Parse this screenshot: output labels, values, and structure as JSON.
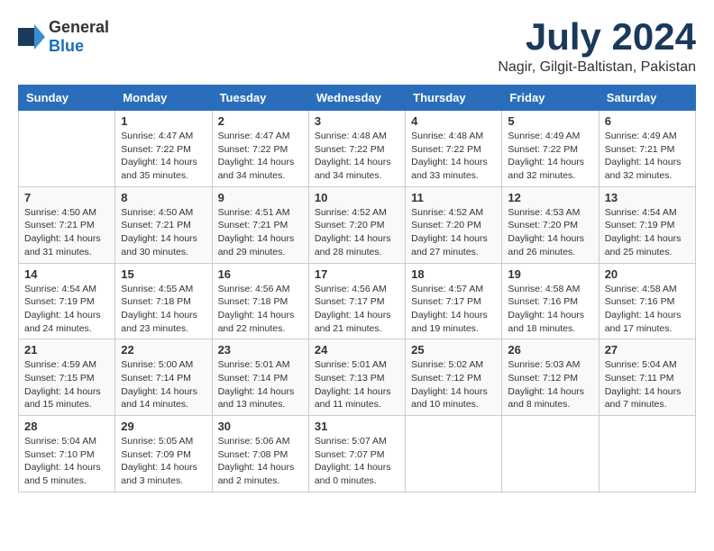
{
  "header": {
    "logo_general": "General",
    "logo_blue": "Blue",
    "month_title": "July 2024",
    "location": "Nagir, Gilgit-Baltistan, Pakistan"
  },
  "days_of_week": [
    "Sunday",
    "Monday",
    "Tuesday",
    "Wednesday",
    "Thursday",
    "Friday",
    "Saturday"
  ],
  "weeks": [
    [
      {
        "day": "",
        "sunrise": "",
        "sunset": "",
        "daylight": ""
      },
      {
        "day": "1",
        "sunrise": "Sunrise: 4:47 AM",
        "sunset": "Sunset: 7:22 PM",
        "daylight": "Daylight: 14 hours and 35 minutes."
      },
      {
        "day": "2",
        "sunrise": "Sunrise: 4:47 AM",
        "sunset": "Sunset: 7:22 PM",
        "daylight": "Daylight: 14 hours and 34 minutes."
      },
      {
        "day": "3",
        "sunrise": "Sunrise: 4:48 AM",
        "sunset": "Sunset: 7:22 PM",
        "daylight": "Daylight: 14 hours and 34 minutes."
      },
      {
        "day": "4",
        "sunrise": "Sunrise: 4:48 AM",
        "sunset": "Sunset: 7:22 PM",
        "daylight": "Daylight: 14 hours and 33 minutes."
      },
      {
        "day": "5",
        "sunrise": "Sunrise: 4:49 AM",
        "sunset": "Sunset: 7:22 PM",
        "daylight": "Daylight: 14 hours and 32 minutes."
      },
      {
        "day": "6",
        "sunrise": "Sunrise: 4:49 AM",
        "sunset": "Sunset: 7:21 PM",
        "daylight": "Daylight: 14 hours and 32 minutes."
      }
    ],
    [
      {
        "day": "7",
        "sunrise": "Sunrise: 4:50 AM",
        "sunset": "Sunset: 7:21 PM",
        "daylight": "Daylight: 14 hours and 31 minutes."
      },
      {
        "day": "8",
        "sunrise": "Sunrise: 4:50 AM",
        "sunset": "Sunset: 7:21 PM",
        "daylight": "Daylight: 14 hours and 30 minutes."
      },
      {
        "day": "9",
        "sunrise": "Sunrise: 4:51 AM",
        "sunset": "Sunset: 7:21 PM",
        "daylight": "Daylight: 14 hours and 29 minutes."
      },
      {
        "day": "10",
        "sunrise": "Sunrise: 4:52 AM",
        "sunset": "Sunset: 7:20 PM",
        "daylight": "Daylight: 14 hours and 28 minutes."
      },
      {
        "day": "11",
        "sunrise": "Sunrise: 4:52 AM",
        "sunset": "Sunset: 7:20 PM",
        "daylight": "Daylight: 14 hours and 27 minutes."
      },
      {
        "day": "12",
        "sunrise": "Sunrise: 4:53 AM",
        "sunset": "Sunset: 7:20 PM",
        "daylight": "Daylight: 14 hours and 26 minutes."
      },
      {
        "day": "13",
        "sunrise": "Sunrise: 4:54 AM",
        "sunset": "Sunset: 7:19 PM",
        "daylight": "Daylight: 14 hours and 25 minutes."
      }
    ],
    [
      {
        "day": "14",
        "sunrise": "Sunrise: 4:54 AM",
        "sunset": "Sunset: 7:19 PM",
        "daylight": "Daylight: 14 hours and 24 minutes."
      },
      {
        "day": "15",
        "sunrise": "Sunrise: 4:55 AM",
        "sunset": "Sunset: 7:18 PM",
        "daylight": "Daylight: 14 hours and 23 minutes."
      },
      {
        "day": "16",
        "sunrise": "Sunrise: 4:56 AM",
        "sunset": "Sunset: 7:18 PM",
        "daylight": "Daylight: 14 hours and 22 minutes."
      },
      {
        "day": "17",
        "sunrise": "Sunrise: 4:56 AM",
        "sunset": "Sunset: 7:17 PM",
        "daylight": "Daylight: 14 hours and 21 minutes."
      },
      {
        "day": "18",
        "sunrise": "Sunrise: 4:57 AM",
        "sunset": "Sunset: 7:17 PM",
        "daylight": "Daylight: 14 hours and 19 minutes."
      },
      {
        "day": "19",
        "sunrise": "Sunrise: 4:58 AM",
        "sunset": "Sunset: 7:16 PM",
        "daylight": "Daylight: 14 hours and 18 minutes."
      },
      {
        "day": "20",
        "sunrise": "Sunrise: 4:58 AM",
        "sunset": "Sunset: 7:16 PM",
        "daylight": "Daylight: 14 hours and 17 minutes."
      }
    ],
    [
      {
        "day": "21",
        "sunrise": "Sunrise: 4:59 AM",
        "sunset": "Sunset: 7:15 PM",
        "daylight": "Daylight: 14 hours and 15 minutes."
      },
      {
        "day": "22",
        "sunrise": "Sunrise: 5:00 AM",
        "sunset": "Sunset: 7:14 PM",
        "daylight": "Daylight: 14 hours and 14 minutes."
      },
      {
        "day": "23",
        "sunrise": "Sunrise: 5:01 AM",
        "sunset": "Sunset: 7:14 PM",
        "daylight": "Daylight: 14 hours and 13 minutes."
      },
      {
        "day": "24",
        "sunrise": "Sunrise: 5:01 AM",
        "sunset": "Sunset: 7:13 PM",
        "daylight": "Daylight: 14 hours and 11 minutes."
      },
      {
        "day": "25",
        "sunrise": "Sunrise: 5:02 AM",
        "sunset": "Sunset: 7:12 PM",
        "daylight": "Daylight: 14 hours and 10 minutes."
      },
      {
        "day": "26",
        "sunrise": "Sunrise: 5:03 AM",
        "sunset": "Sunset: 7:12 PM",
        "daylight": "Daylight: 14 hours and 8 minutes."
      },
      {
        "day": "27",
        "sunrise": "Sunrise: 5:04 AM",
        "sunset": "Sunset: 7:11 PM",
        "daylight": "Daylight: 14 hours and 7 minutes."
      }
    ],
    [
      {
        "day": "28",
        "sunrise": "Sunrise: 5:04 AM",
        "sunset": "Sunset: 7:10 PM",
        "daylight": "Daylight: 14 hours and 5 minutes."
      },
      {
        "day": "29",
        "sunrise": "Sunrise: 5:05 AM",
        "sunset": "Sunset: 7:09 PM",
        "daylight": "Daylight: 14 hours and 3 minutes."
      },
      {
        "day": "30",
        "sunrise": "Sunrise: 5:06 AM",
        "sunset": "Sunset: 7:08 PM",
        "daylight": "Daylight: 14 hours and 2 minutes."
      },
      {
        "day": "31",
        "sunrise": "Sunrise: 5:07 AM",
        "sunset": "Sunset: 7:07 PM",
        "daylight": "Daylight: 14 hours and 0 minutes."
      },
      {
        "day": "",
        "sunrise": "",
        "sunset": "",
        "daylight": ""
      },
      {
        "day": "",
        "sunrise": "",
        "sunset": "",
        "daylight": ""
      },
      {
        "day": "",
        "sunrise": "",
        "sunset": "",
        "daylight": ""
      }
    ]
  ]
}
